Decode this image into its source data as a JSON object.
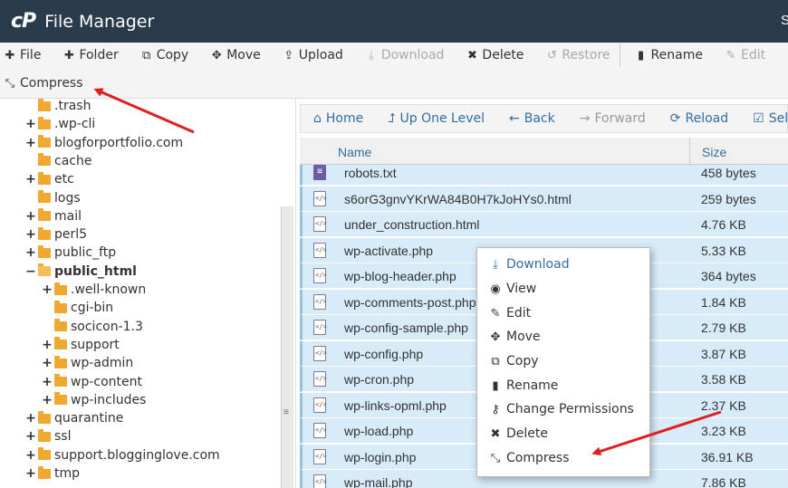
{
  "header": {
    "logo": "cP",
    "title": "File Manager",
    "right_text": "S"
  },
  "toolbar": {
    "file": "File",
    "folder": "Folder",
    "copy": "Copy",
    "move": "Move",
    "upload": "Upload",
    "download": "Download",
    "delete": "Delete",
    "restore": "Restore",
    "rename": "Rename",
    "edit": "Edit",
    "compress": "Compress"
  },
  "tree": [
    {
      "label": ".trash",
      "toggle": ""
    },
    {
      "label": ".wp-cli",
      "toggle": "+"
    },
    {
      "label": "blogforportfolio.com",
      "toggle": "+"
    },
    {
      "label": "cache",
      "toggle": ""
    },
    {
      "label": "etc",
      "toggle": "+"
    },
    {
      "label": "logs",
      "toggle": ""
    },
    {
      "label": "mail",
      "toggle": "+"
    },
    {
      "label": "perl5",
      "toggle": "+"
    },
    {
      "label": "public_ftp",
      "toggle": "+"
    },
    {
      "label": "public_html",
      "toggle": "−"
    },
    {
      "label": ".well-known",
      "toggle": "+"
    },
    {
      "label": "cgi-bin",
      "toggle": ""
    },
    {
      "label": "socicon-1.3",
      "toggle": ""
    },
    {
      "label": "support",
      "toggle": "+"
    },
    {
      "label": "wp-admin",
      "toggle": "+"
    },
    {
      "label": "wp-content",
      "toggle": "+"
    },
    {
      "label": "wp-includes",
      "toggle": "+"
    },
    {
      "label": "quarantine",
      "toggle": "+"
    },
    {
      "label": "ssl",
      "toggle": "+"
    },
    {
      "label": "support.bloggingl​ove.com",
      "toggle": "+"
    },
    {
      "label": "tmp",
      "toggle": "+"
    }
  ],
  "nav": {
    "home": "Home",
    "up_one_level": "Up One Level",
    "back": "Back",
    "forward": "Forward",
    "reload": "Reload",
    "select_all": "Selec"
  },
  "list": {
    "col_name": "Name",
    "col_size": "Size",
    "rows": [
      {
        "name": "robots.txt",
        "size": "458 bytes",
        "icon": "text-file-icon"
      },
      {
        "name": "s6orG3gnvYKrWA84B0H7kJoHYs0.html",
        "size": "259 bytes",
        "icon": "code-file-icon"
      },
      {
        "name": "under_construction.html",
        "size": "4.76 KB",
        "icon": "code-file-icon"
      },
      {
        "name": "wp-activate.php",
        "size": "5.33 KB",
        "icon": "code-file-icon"
      },
      {
        "name": "wp-blog-header.php",
        "size": "364 bytes",
        "icon": "code-file-icon"
      },
      {
        "name": "wp-comments-post.php",
        "size": "1.84 KB",
        "icon": "code-file-icon"
      },
      {
        "name": "wp-config-sample.php",
        "size": "2.79 KB",
        "icon": "code-file-icon"
      },
      {
        "name": "wp-config.php",
        "size": "3.87 KB",
        "icon": "code-file-icon"
      },
      {
        "name": "wp-cron.php",
        "size": "3.58 KB",
        "icon": "code-file-icon"
      },
      {
        "name": "wp-links-opml.php",
        "size": "2.37 KB",
        "icon": "code-file-icon"
      },
      {
        "name": "wp-load.php",
        "size": "3.23 KB",
        "icon": "code-file-icon"
      },
      {
        "name": "wp-login.php",
        "size": "36.91 KB",
        "icon": "code-file-icon"
      },
      {
        "name": "wp-mail.php",
        "size": "7.86 KB",
        "icon": "code-file-icon"
      }
    ]
  },
  "context_menu": {
    "download": "Download",
    "view": "View",
    "edit": "Edit",
    "move": "Move",
    "copy": "Copy",
    "rename": "Rename",
    "change_permissions": "Change Permissions",
    "delete": "Delete",
    "compress": "Compress"
  },
  "colors": {
    "header_bg": "#293a4a",
    "link": "#2f6ea5",
    "selected_row": "#d7ebf8",
    "arrow": "#e02020",
    "folder": "#f0a830"
  }
}
